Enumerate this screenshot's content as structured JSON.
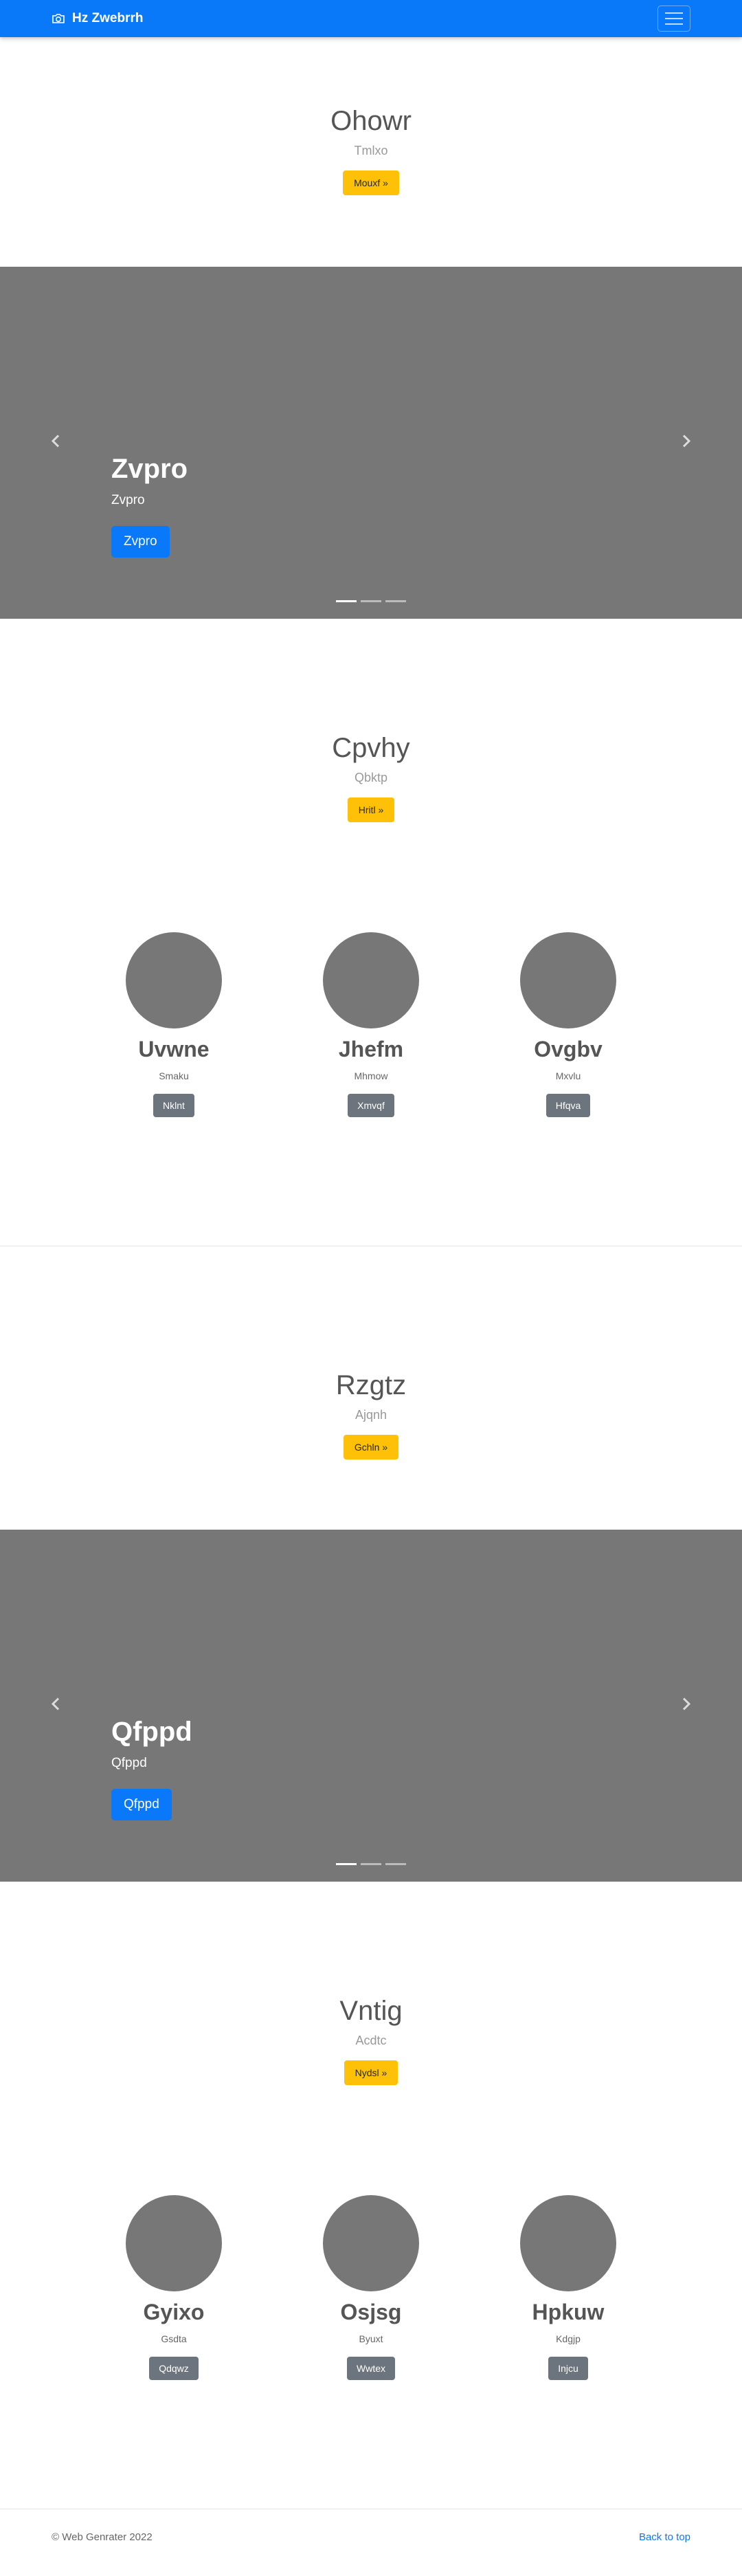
{
  "navbar": {
    "brand": "Hz Zwebrrh",
    "brand_icon": "camera-icon",
    "toggler_icon": "hamburger-icon"
  },
  "jumbotrons": [
    {
      "title": "Ohowr",
      "subtitle": "Tmlxo",
      "button": "Mouxf »"
    },
    {
      "title": "Cpvhy",
      "subtitle": "Qbktp",
      "button": "Hritl »"
    },
    {
      "title": "Rzgtz",
      "subtitle": "Ajqnh",
      "button": "Gchln »"
    },
    {
      "title": "Vntig",
      "subtitle": "Acdtc",
      "button": "Nydsl »"
    }
  ],
  "carousels": [
    {
      "title": "Zvpro",
      "text": "Zvpro",
      "button": "Zvpro",
      "slides": 3,
      "active": 0
    },
    {
      "title": "Qfppd",
      "text": "Qfppd",
      "button": "Qfppd",
      "slides": 3,
      "active": 0
    }
  ],
  "marketing": [
    [
      {
        "name": "Uvwne",
        "desc": "Smaku",
        "button": "Nklnt"
      },
      {
        "name": "Jhefm",
        "desc": "Mhmow",
        "button": "Xmvqf"
      },
      {
        "name": "Ovgbv",
        "desc": "Mxvlu",
        "button": "Hfqva"
      }
    ],
    [
      {
        "name": "Gyixo",
        "desc": "Gsdta",
        "button": "Qdqwz"
      },
      {
        "name": "Osjsg",
        "desc": "Byuxt",
        "button": "Wwtex"
      },
      {
        "name": "Hpkuw",
        "desc": "Kdgjp",
        "button": "Injcu"
      }
    ]
  ],
  "footer": {
    "copyright": "© Web Genrater 2022",
    "back_to_top": "Back to top"
  },
  "colors": {
    "primary": "#0a79f9",
    "warning": "#ffc107",
    "secondary": "#6c757d",
    "placeholder": "#777777"
  }
}
